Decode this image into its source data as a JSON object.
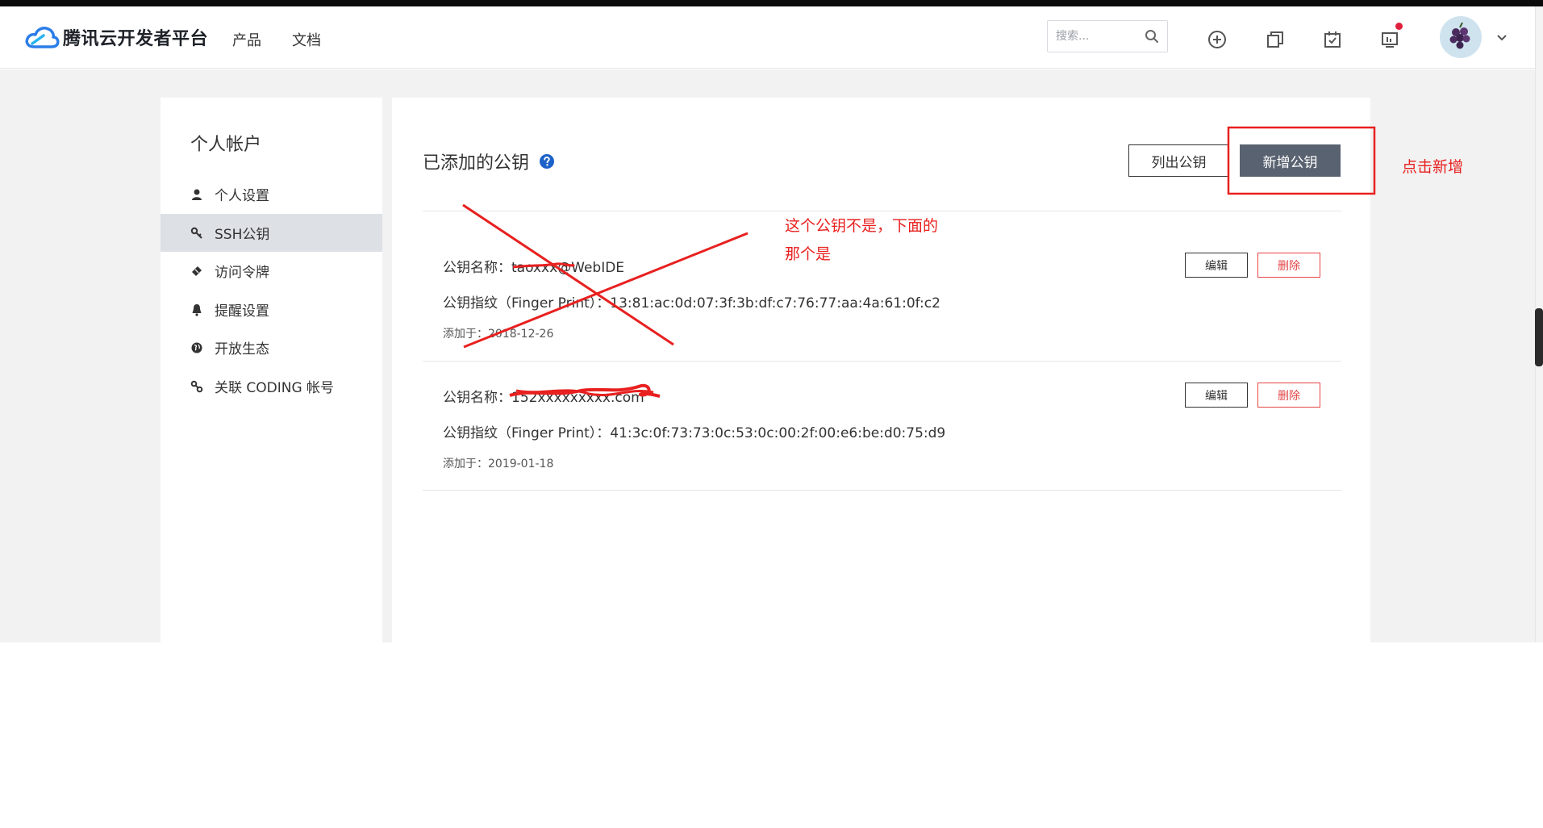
{
  "header": {
    "brand": "腾讯云开发者平台",
    "nav": [
      {
        "label": "产品"
      },
      {
        "label": "文档"
      }
    ],
    "search_placeholder": "搜索...",
    "icons": [
      "plus-circle-icon",
      "copy-icon",
      "calendar-check-icon",
      "presentation-icon"
    ],
    "notification_color": "#e01f3d"
  },
  "sidebar": {
    "title": "个人帐户",
    "items": [
      {
        "label": "个人设置",
        "icon": "user-icon"
      },
      {
        "label": "SSH公钥",
        "icon": "key-icon",
        "active": true
      },
      {
        "label": "访问令牌",
        "icon": "ticket-icon"
      },
      {
        "label": "提醒设置",
        "icon": "bell-icon"
      },
      {
        "label": "开放生态",
        "icon": "globe-icon"
      },
      {
        "label": "关联 CODING 帐号",
        "icon": "link-icon"
      }
    ]
  },
  "main": {
    "title": "已添加的公钥",
    "list_button": "列出公钥",
    "add_button": "新增公钥",
    "keys": [
      {
        "name": "公钥名称：taoxxx@WebIDE",
        "fingerprint": "公钥指纹（Finger Print）：13:81:ac:0d:07:3f:3b:df:c7:76:77:aa:4a:61:0f:c2",
        "added": "添加于：2018-12-26",
        "edit": "编辑",
        "delete": "删除"
      },
      {
        "name": "公钥名称：152xxxxxxxxx.com",
        "fingerprint": "公钥指纹（Finger Print）：41:3c:0f:73:73:0c:53:0c:00:2f:00:e6:be:d0:75:d9",
        "added": "添加于：2019-01-18",
        "edit": "编辑",
        "delete": "删除"
      }
    ]
  },
  "annotations": {
    "click_add": "点击新增",
    "not_this_key_line1": "这个公钥不是，下面的",
    "not_this_key_line2": "那个是",
    "color": "#e8201f"
  },
  "colors": {
    "primary_button": "#596270",
    "danger": "#e54545",
    "brand_blue": "#2b7de9",
    "page_background": "#f2f2f2",
    "active_item": "#dde0e5"
  }
}
